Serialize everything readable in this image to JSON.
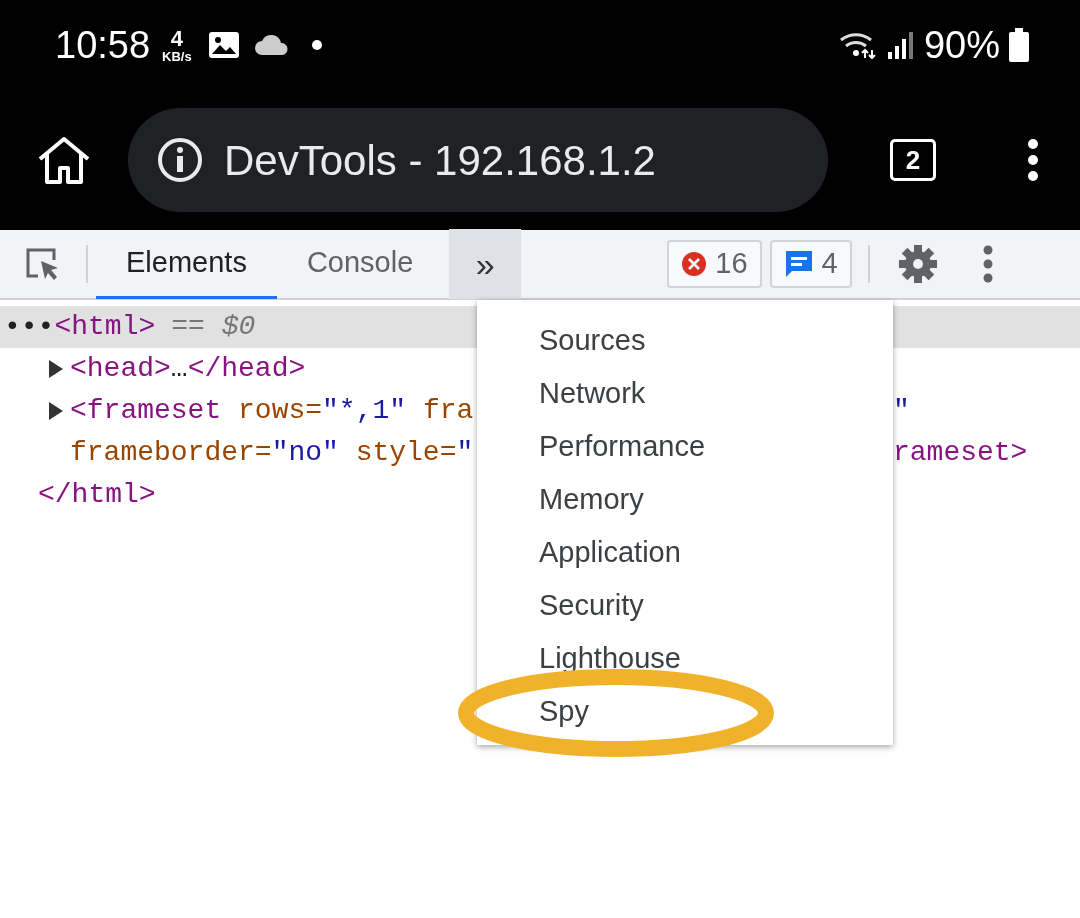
{
  "status_bar": {
    "time": "10:58",
    "net_speed": "4",
    "net_unit": "KB/s",
    "battery": "90%"
  },
  "address_bar": {
    "title": "DevTools - 192.168.1.2",
    "tab_count": "2"
  },
  "devtools": {
    "tabs": [
      {
        "label": "Elements",
        "selected": true
      },
      {
        "label": "Console",
        "selected": false
      }
    ],
    "more_tabs": {
      "label": "»",
      "expanded": true
    },
    "errors": "16",
    "messages": "4"
  },
  "dom_tree": {
    "marker": "•••",
    "selected": true,
    "open": [
      {
        "text": "<html>",
        "kind": "tag"
      }
    ],
    "note": "== $0",
    "children": [
      {
        "expanded": false,
        "lines": [
          {
            "left": [
              {
                "text": "<head>",
                "kind": "tag"
              },
              {
                "text": "…",
                "kind": "plain"
              },
              {
                "text": "</head>",
                "kind": "tag"
              }
            ]
          }
        ]
      },
      {
        "expanded": false,
        "lines": [
          {
            "left": [
              {
                "text": "<frameset",
                "kind": "tag"
              },
              {
                "text": " rows=",
                "kind": "attr"
              },
              {
                "text": "\"*,1\"",
                "kind": "value"
              },
              {
                "text": " fra",
                "kind": "attr"
              }
            ],
            "right": [
              {
                "text": "\"",
                "kind": "value"
              }
            ]
          },
          {
            "left": [
              {
                "text": "frameborder=",
                "kind": "attr"
              },
              {
                "text": "\"no\"",
                "kind": "value"
              },
              {
                "text": " style=",
                "kind": "attr"
              },
              {
                "text": "\"",
                "kind": "value"
              }
            ],
            "right": [
              {
                "text": "rameset>",
                "kind": "tag"
              }
            ]
          }
        ]
      }
    ],
    "close": [
      {
        "text": "</html>",
        "kind": "tag"
      }
    ]
  },
  "menu": {
    "items": [
      "Sources",
      "Network",
      "Performance",
      "Memory",
      "Application",
      "Security",
      "Lighthouse",
      "Spy"
    ]
  }
}
